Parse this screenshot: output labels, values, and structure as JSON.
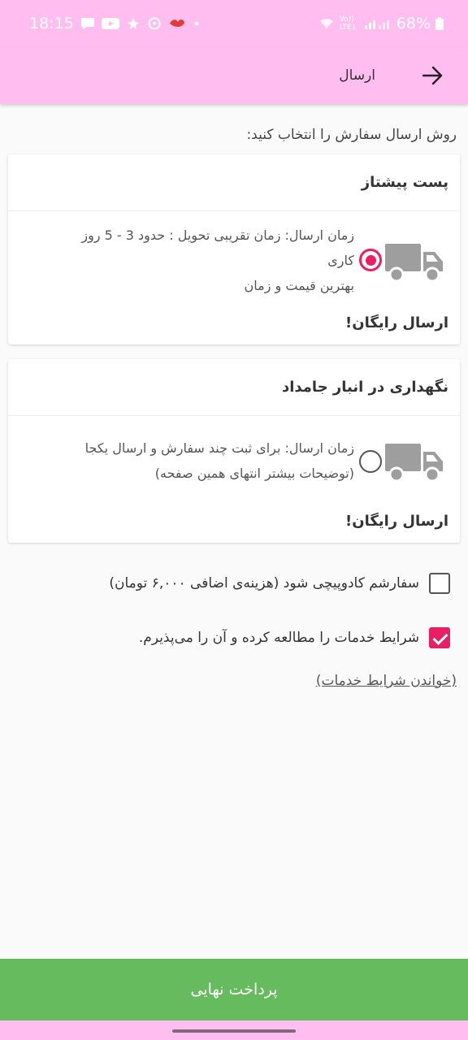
{
  "status_bar": {
    "time": "18:15",
    "network": "Vo)) LTE1",
    "battery": "68%"
  },
  "app_bar": {
    "title": "ارسال",
    "back_icon": "arrow-right-icon"
  },
  "shipping": {
    "prompt": "روش ارسال سفارش را انتخاب کنید:",
    "options": [
      {
        "title": "پست پیشتاز",
        "line1": "زمان ارسال: زمان تقریبی تحویل : حدود 3 - 5 روز",
        "line2": "کاری",
        "line3": "بهترین قیمت و زمان",
        "footer": "ارسال رایگان!",
        "selected": true,
        "icon": "truck-icon"
      },
      {
        "title": "نگهداری در انبار جامداد",
        "line1": "زمان ارسال: برای ثبت چند سفارش و ارسال یکجا",
        "line2": "(توضیحات بیشتر انتهای همین صفحه)",
        "footer": "ارسال رایگان!",
        "selected": false,
        "icon": "truck-icon"
      }
    ]
  },
  "options": {
    "gift_wrap": {
      "label": "سفارشم کادوپیچی شود (هزینه‌ی اضافی ۶,۰۰۰ تومان)",
      "checked": false
    },
    "terms_accept": {
      "label": "شرایط خدمات را مطالعه کرده و آن را می‌پذیرم.",
      "checked": true
    }
  },
  "terms_link": "(خواندن شرایط خدمات)",
  "pay_button": "پرداخت نهایی",
  "colors": {
    "accent": "#e91e63",
    "header": "#ffbdf0",
    "pay": "#66bb5f",
    "truck": "#9e9e9e"
  }
}
